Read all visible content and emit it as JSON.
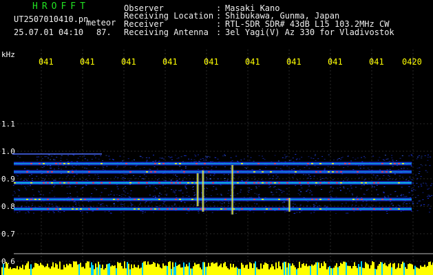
{
  "header": {
    "app_name": "HROFFT",
    "filename": "UT2507010410.pn",
    "mode": "meteor",
    "datetime": "25.07.01 04:10",
    "value": "87.",
    "fields": [
      {
        "label": "Observer",
        "sep": ":",
        "value": "Masaki Kano"
      },
      {
        "label": "Receiving Location",
        "sep": ":",
        "value": "Shibukawa, Gunma, Japan"
      },
      {
        "label": "Receiver",
        "sep": ":",
        "value": "RTL-SDR SDR# 43dB L15 103.2MHz CW"
      },
      {
        "label": "Receiving Antenna",
        "sep": ":",
        "value": "3el Yagi(V) Az 330 for Vladivostok"
      }
    ]
  },
  "colors": {
    "background": "#000000",
    "grid": "#2a2a2a",
    "tick_text": "#ffff00",
    "header_green": "#22e022",
    "signal_blue": "#1e3cff",
    "signal_hot": "#ffff00",
    "bottom_bar": "#ffff00",
    "bottom_bar_alt": "#00d0ff"
  },
  "chart_data": {
    "type": "heatmap",
    "y_unit_label": "kHz",
    "y_ticks": [
      "1.1",
      "1.0",
      "0.9",
      "0.8",
      "0.7",
      "0.6"
    ],
    "y_tick_values": [
      1.1,
      1.0,
      0.9,
      0.8,
      0.7,
      0.6
    ],
    "x_ticks": [
      "041",
      "041",
      "041",
      "041",
      "041",
      "041",
      "041",
      "041",
      "041",
      "0420"
    ],
    "ylim": [
      0.6,
      1.1
    ],
    "grid": true,
    "bands": [
      {
        "kHz": 0.955,
        "start_min": 0,
        "end_min": 10,
        "intensity": 0.55
      },
      {
        "kHz": 0.925,
        "start_min": 0,
        "end_min": 10,
        "intensity": 0.45
      },
      {
        "kHz": 0.885,
        "start_min": 0,
        "end_min": 10,
        "intensity": 0.85
      },
      {
        "kHz": 0.825,
        "start_min": 0,
        "end_min": 10,
        "intensity": 0.6
      },
      {
        "kHz": 0.79,
        "start_min": 0,
        "end_min": 10,
        "intensity": 0.75
      }
    ],
    "meteor_streaks": [
      {
        "minute": 4.75,
        "kHz_from": 0.8,
        "kHz_to": 0.92
      },
      {
        "minute": 4.88,
        "kHz_from": 0.78,
        "kHz_to": 0.93
      },
      {
        "minute": 5.6,
        "kHz_from": 0.77,
        "kHz_to": 0.95
      },
      {
        "minute": 7.0,
        "kHz_from": 0.78,
        "kHz_to": 0.83
      }
    ]
  }
}
